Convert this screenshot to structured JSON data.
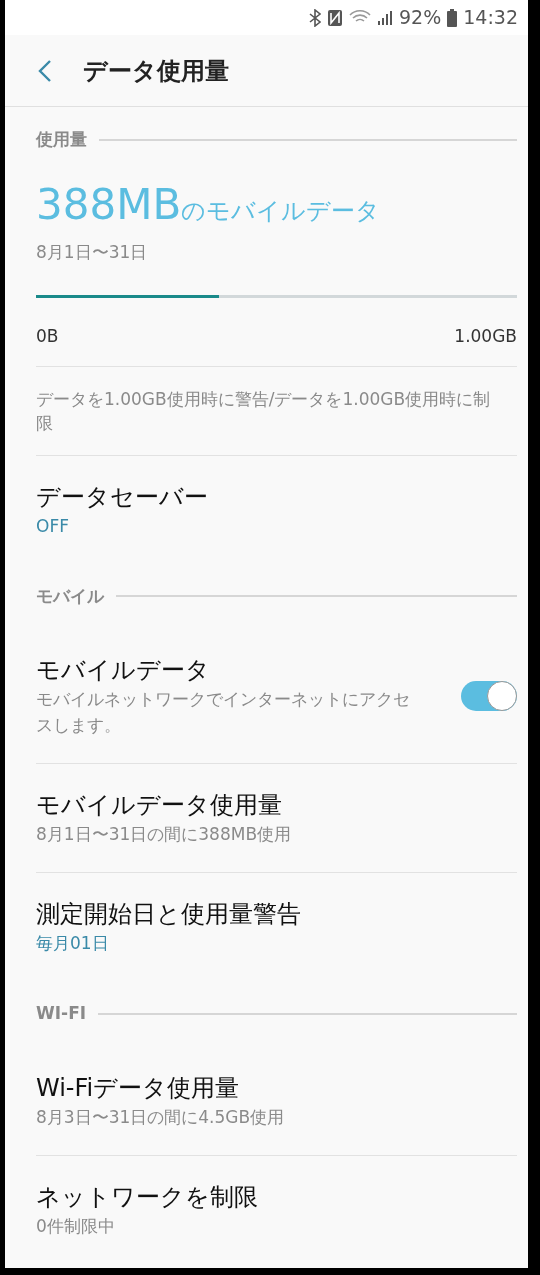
{
  "status_bar": {
    "battery": "92%",
    "time": "14:32"
  },
  "header": {
    "title": "データ使用量"
  },
  "sections": [
    {
      "title": "使用量",
      "usage": {
        "amount": "388MB",
        "amount_suffix": "のモバイルデータ",
        "period": "8月1日〜31日",
        "level": 0.38,
        "min_label": "0B",
        "max_label": "1.00GB",
        "note": "データを1.00GB使用時に警告/データを1.00GB使用時に制限"
      },
      "items": [
        {
          "kind": "value",
          "title": "データセーバー",
          "subtitle": "OFF"
        }
      ]
    },
    {
      "title": "モバイル",
      "items": [
        {
          "kind": "toggle",
          "title": "モバイルデータ",
          "subtitle": "モバイルネットワークでインターネットにアクセスします。",
          "on": true
        },
        {
          "kind": "summary",
          "title": "モバイルデータ使用量",
          "subtitle": "8月1日〜31日の間に388MB使用"
        },
        {
          "kind": "value",
          "title": "測定開始日と使用量警告",
          "subtitle": "毎月01日"
        }
      ]
    },
    {
      "title": "WI-FI",
      "items": [
        {
          "kind": "summary",
          "title": "Wi-Fiデータ使用量",
          "subtitle": "8月3日〜31日の間に4.5GB使用"
        },
        {
          "kind": "summary",
          "title": "ネットワークを制限",
          "subtitle": "0件制限中"
        }
      ]
    }
  ]
}
